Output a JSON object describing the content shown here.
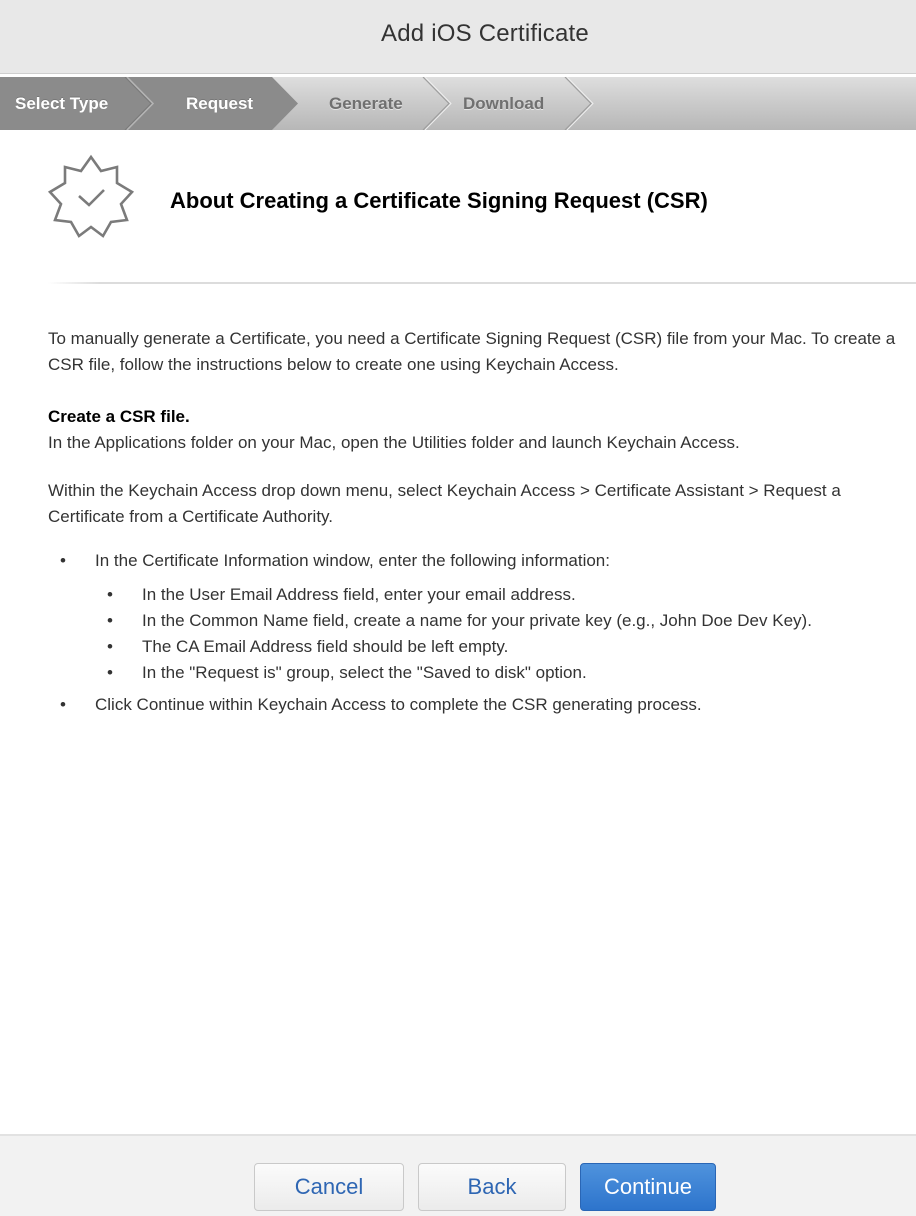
{
  "window": {
    "title": "Add iOS Certificate"
  },
  "steps": [
    {
      "label": "Select Type",
      "state": "completed"
    },
    {
      "label": "Request",
      "state": "current"
    },
    {
      "label": "Generate",
      "state": "upcoming"
    },
    {
      "label": "Download",
      "state": "upcoming"
    }
  ],
  "header": {
    "icon": "certificate-badge-checkmark-icon",
    "heading": "About Creating a Certificate Signing Request (CSR)"
  },
  "content": {
    "intro": "To manually generate a Certificate, you need a Certificate Signing Request (CSR) file from your Mac. To create a CSR file, follow the instructions below to create one using Keychain Access.",
    "section_heading": "Create a CSR file.",
    "para_launch": "In the Applications folder on your Mac, open the Utilities folder and launch Keychain Access.",
    "para_menu": "Within the Keychain Access drop down menu, select Keychain Access > Certificate Assistant > Request a Certificate from a Certificate Authority.",
    "bullet_marker": "•",
    "bullets": [
      {
        "text": "In the Certificate Information window, enter the following information:",
        "sub": [
          "In the User Email Address field, enter your email address.",
          "In the Common Name field, create a name for your private key (e.g., John Doe Dev Key).",
          "The CA Email Address field should be left empty.",
          "In the \"Request is\" group, select the \"Saved to disk\" option."
        ]
      },
      {
        "text": "Click Continue within Keychain Access to complete the CSR generating process."
      }
    ]
  },
  "footer": {
    "cancel_label": "Cancel",
    "back_label": "Back",
    "continue_label": "Continue"
  },
  "colors": {
    "accent": "#2e74cc",
    "link_text": "#2e66b3",
    "step_done": "#8a8a8a"
  }
}
